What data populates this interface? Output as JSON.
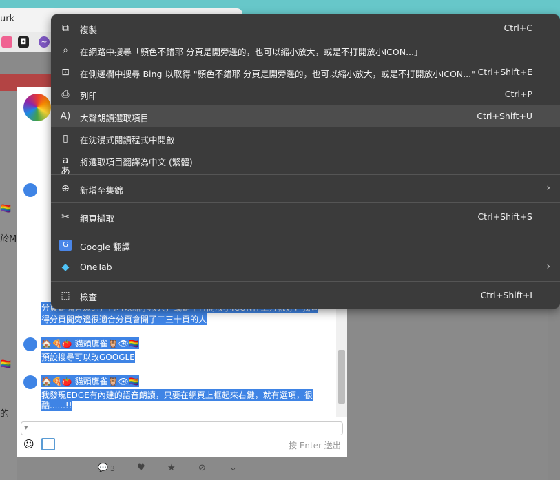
{
  "browser": {
    "tab_title": "urk",
    "bookmark_icons": [
      "a-icon",
      "s-icon",
      "messenger-icon"
    ]
  },
  "background_page": {
    "left_text_1": "於M",
    "left_text_2": "的",
    "chat_messages": [
      {
        "line": "分頁是偏旁邊的，也可以縮小放大，或是不打開放小ICON在上方就好，我覺"
      },
      {
        "line": "得分頁開旁邊很適合分頁會開了二三十頁的人"
      },
      {
        "line": "🏠🍕🍅 貓頭鷹雀🦉👁🏳️‍🌈"
      },
      {
        "line": "預設搜尋可以改GOOGLE"
      },
      {
        "line": "🏠🍕🍅 貓頭鷹雀🦉👁🏳️‍🌈"
      },
      {
        "line": "我發現EDGE有內建的語音朗讀，只要在網頁上框起來右鍵，就有選項，很"
      },
      {
        "line": "酷......!!"
      }
    ],
    "enter_hint": "按 Enter 送出",
    "comment_count": "3"
  },
  "context_menu": {
    "items": [
      {
        "label": "複製",
        "shortcut": "Ctrl+C",
        "icon": "copy-icon"
      },
      {
        "label": "在網路中搜尋「顏色不錯耶  分頁是開旁邊的，也可以縮小放大，或是不打開放小ICON...」",
        "shortcut": "",
        "icon": "search-icon"
      },
      {
        "label": "在側邊欄中搜尋 Bing 以取得 \"顏色不錯耶  分頁是開旁邊的，也可以縮小放大，或是不打開放小ICON...\"",
        "shortcut": "Ctrl+Shift+E",
        "icon": "sidebar-search-icon"
      },
      {
        "label": "列印",
        "shortcut": "Ctrl+P",
        "icon": "print-icon"
      },
      {
        "label": "大聲朗讀選取項目",
        "shortcut": "Ctrl+Shift+U",
        "icon": "read-aloud-icon"
      },
      {
        "label": "在沈浸式閱讀程式中開啟",
        "shortcut": "",
        "icon": "immersive-reader-icon"
      },
      {
        "label": "將選取項目翻譯為中文 (繁體)",
        "shortcut": "",
        "icon": "translate-icon"
      },
      {
        "label": "新增至集錦",
        "shortcut": "",
        "icon": "collections-icon"
      },
      {
        "label": "網頁擷取",
        "shortcut": "Ctrl+Shift+S",
        "icon": "web-capture-icon"
      },
      {
        "label": "Google 翻譯",
        "shortcut": "",
        "icon": "google-translate-icon"
      },
      {
        "label": "OneTab",
        "shortcut": "",
        "icon": "onetab-icon"
      },
      {
        "label": "檢查",
        "shortcut": "Ctrl+Shift+I",
        "icon": "inspect-icon"
      }
    ]
  }
}
